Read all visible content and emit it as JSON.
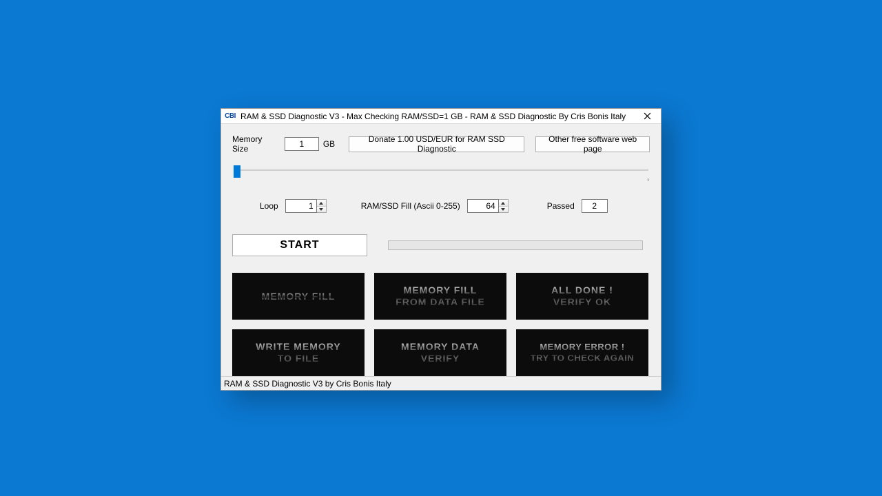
{
  "title_icon": "CBI",
  "window_title": "RAM & SSD Diagnostic V3 - Max Checking RAM/SSD=1 GB - RAM & SSD Diagnostic By Cris Bonis Italy",
  "row1": {
    "memory_size_label": "Memory Size",
    "memory_size_value": "1",
    "memory_size_unit": "GB",
    "donate_label": "Donate 1.00 USD/EUR for RAM  SSD Diagnostic",
    "other_label": "Other free software web page"
  },
  "row2": {
    "loop_label": "Loop",
    "loop_value": "1",
    "fill_label": "RAM/SSD Fill (Ascii 0-255)",
    "fill_value": "64",
    "passed_label": "Passed",
    "passed_value": "2"
  },
  "start_label": "START",
  "panels": {
    "p1": "MEMORY FILL",
    "p2": "MEMORY FILL\nFROM DATA FILE",
    "p3": "ALL DONE !\nVERIFY OK",
    "p4": "WRITE MEMORY\nTO FILE",
    "p5": "MEMORY DATA\nVERIFY",
    "p6": "MEMORY ERROR !\nTRY TO CHECK AGAIN"
  },
  "status": "RAM & SSD Diagnostic V3 by Cris Bonis Italy"
}
